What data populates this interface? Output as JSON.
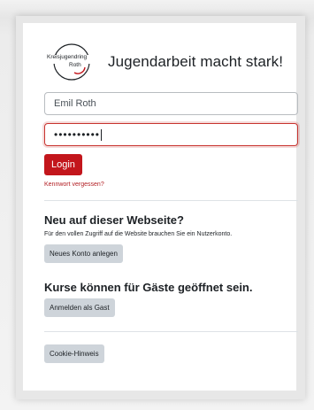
{
  "brand": {
    "logo_text_line1": "Kreisjugendring",
    "logo_text_line2": "Roth",
    "site_title": "Jugendarbeit macht stark!"
  },
  "login": {
    "username_value": "Emil Roth",
    "password_value": "••••••••••",
    "login_button": "Login",
    "forgot_link": "Kennwort vergessen?"
  },
  "signup": {
    "heading": "Neu auf dieser Webseite?",
    "description": "Für den vollen Zugriff auf die Website brauchen Sie ein Nutzerkonto.",
    "button": "Neues Konto anlegen"
  },
  "guest": {
    "heading": "Kurse können für Gäste geöffnet sein.",
    "button": "Anmelden als Gast"
  },
  "cookie": {
    "button": "Cookie-Hinweis"
  },
  "colors": {
    "primary": "#c3161c",
    "secondary_button": "#ced4da",
    "focus_border": "#c8332f"
  }
}
